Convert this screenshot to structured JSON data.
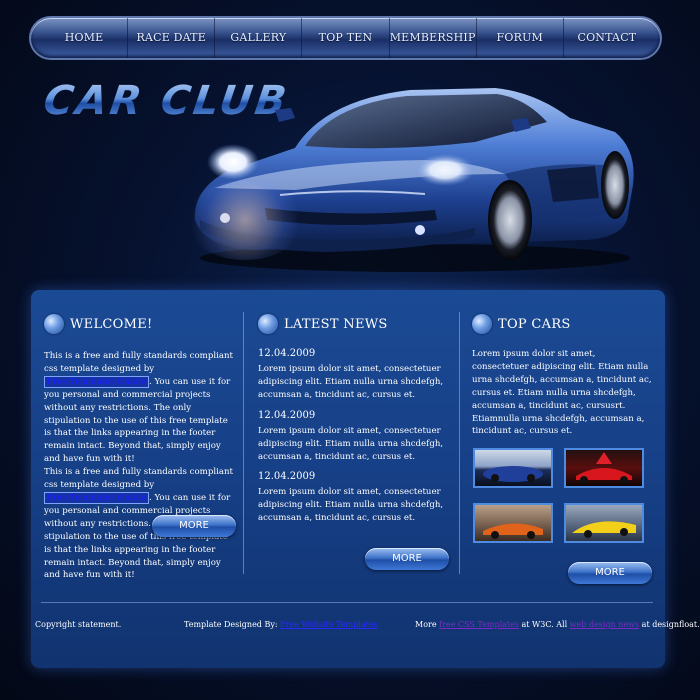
{
  "nav": {
    "items": [
      "HOME",
      "RACE DATE",
      "GALLERY",
      "TOP TEN",
      "MEMBERSHIP",
      "FORUM",
      "CONTACT"
    ]
  },
  "logo": {
    "text": "CAR CLUB"
  },
  "welcome": {
    "title": "WELCOME!",
    "p1_a": "This is a free and fully standards compliant css template designed by",
    "p1_link": "Free Templates Online",
    "p1_b": ". You can use it for you personal and commercial projects without any restrictions. The only stipulation to the use of this free template is that the links appearing in the footer remain intact. Beyond that, simply enjoy and have fun with it!",
    "p2_a": "This is a free and fully standards compliant css template designed by",
    "p2_link": "Free Templates Online",
    "p2_b": ". You can use it for you personal and commercial projects without any restrictions. The only stipulation to the use of this free template is that the links appearing in the footer remain intact. Beyond that, simply enjoy and have fun with it!",
    "more": "MORE"
  },
  "news": {
    "title": "LATEST NEWS",
    "items": [
      {
        "date": "12.04.2009",
        "text": "Lorem ipsum dolor sit amet, consectetuer adipiscing elit. Etiam nulla urna shcdefgh, accumsan a, tincidunt ac, cursus et."
      },
      {
        "date": "12.04.2009",
        "text": "Lorem ipsum dolor sit amet, consectetuer adipiscing elit. Etiam nulla urna shcdefgh, accumsan a, tincidunt ac, cursus et."
      },
      {
        "date": "12.04.2009",
        "text": "Lorem ipsum dolor sit amet, consectetuer adipiscing elit. Etiam nulla urna shcdefgh, accumsan a, tincidunt ac, cursus et."
      }
    ],
    "more": "MORE"
  },
  "topcars": {
    "title": "TOP CARS",
    "text": "Lorem ipsum dolor sit amet, consectetuer adipiscing elit. Etiam nulla urna shcdefgh, accumsan a, tincidunt ac, cursus et. Etiam nulla urna shcdefgh, accumsan a, tincidunt ac, cursusrt. Etiamnulla urna shcdefgh, accumsan a, tincidunt ac, cursus et.",
    "more": "MORE"
  },
  "footer": {
    "copyright": "Copyright statement.",
    "designed_by": "Template Designed By:",
    "designed_link": "Free Website Templates",
    "more_prefix": "More",
    "more_link": "free CSS Templates",
    "more_mid": "at W3C. All",
    "more_link2": "web design news",
    "more_suffix": "at designfloat.com!"
  },
  "colors": {
    "accent": "#4f8be0",
    "panel": "#163f86",
    "background": "#061230"
  }
}
